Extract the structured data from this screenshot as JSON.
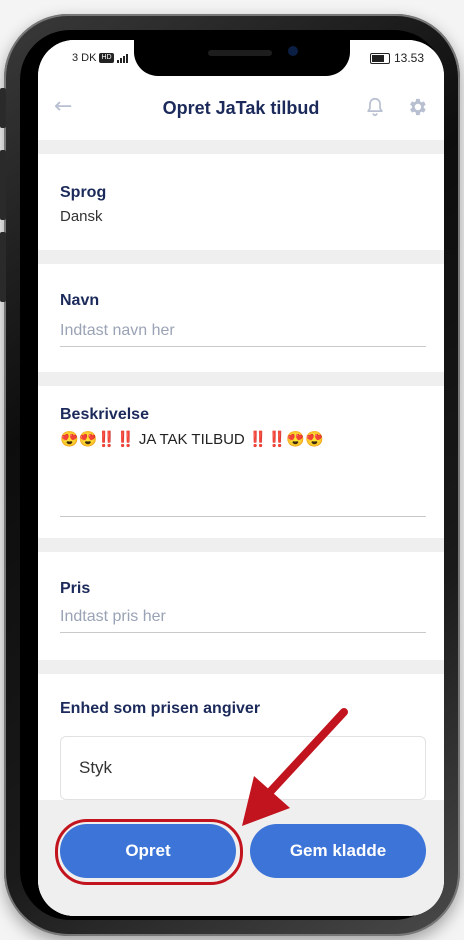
{
  "status_bar": {
    "carrier": "3 DK",
    "network_badge": "HD",
    "time": "13.53"
  },
  "header": {
    "title": "Opret JaTak tilbud",
    "back_icon": "arrow-left-icon",
    "bell_icon": "bell-icon",
    "settings_icon": "gear-icon"
  },
  "fields": {
    "language": {
      "label": "Sprog",
      "value": "Dansk"
    },
    "name": {
      "label": "Navn",
      "placeholder": "Indtast navn her"
    },
    "description": {
      "label": "Beskrivelse",
      "value": "😍😍‼️‼️ JA TAK TILBUD ‼️‼️😍😍"
    },
    "price": {
      "label": "Pris",
      "placeholder": "Indtast pris her"
    },
    "unit": {
      "label": "Enhed som prisen angiver",
      "value": "Styk"
    }
  },
  "actions": {
    "create_label": "Opret",
    "save_draft_label": "Gem kladde"
  },
  "colors": {
    "title": "#1b2a5a",
    "primary_button": "#3d74d8",
    "highlight": "#c2141e"
  }
}
